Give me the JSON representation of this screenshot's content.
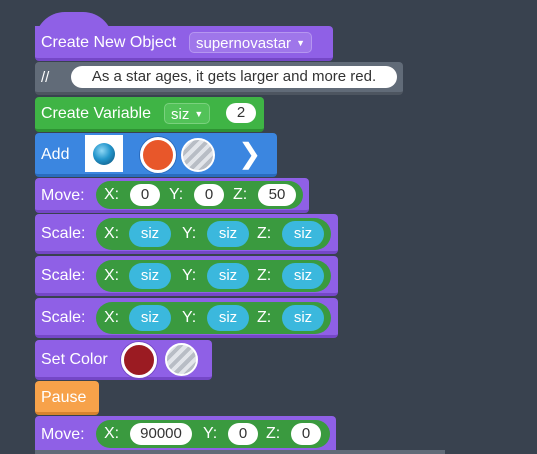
{
  "blocks": {
    "create_object": {
      "label": "Create New Object",
      "dropdown": "supernovastar"
    },
    "comment": {
      "marker": "//",
      "text": "As a star ages, it gets larger and more red."
    },
    "create_variable": {
      "label": "Create Variable",
      "dropdown": "siz",
      "value": "2"
    },
    "add": {
      "label": "Add",
      "arrow": "chevron-right-icon"
    },
    "move1": {
      "label": "Move:",
      "x_label": "X:",
      "x": "0",
      "y_label": "Y:",
      "y": "0",
      "z_label": "Z:",
      "z": "50"
    },
    "scales": [
      {
        "label": "Scale:",
        "x_label": "X:",
        "x": "siz",
        "y_label": "Y:",
        "y": "siz",
        "z_label": "Z:",
        "z": "siz"
      },
      {
        "label": "Scale:",
        "x_label": "X:",
        "x": "siz",
        "y_label": "Y:",
        "y": "siz",
        "z_label": "Z:",
        "z": "siz"
      },
      {
        "label": "Scale:",
        "x_label": "X:",
        "x": "siz",
        "y_label": "Y:",
        "y": "siz",
        "z_label": "Z:",
        "z": "siz"
      }
    ],
    "set_color": {
      "label": "Set Color"
    },
    "pause": {
      "label": "Pause"
    },
    "move2": {
      "label": "Move:",
      "x_label": "X:",
      "x": "90000",
      "y_label": "Y:",
      "y": "0",
      "z_label": "Z:",
      "z": "0"
    }
  },
  "colors": {
    "background": "#39424f",
    "purple": "#8f60e6",
    "green": "#3fb445",
    "blue": "#3b86e0",
    "orange": "#f7a24a",
    "cyan": "#3bb8dd",
    "selected_color_red": "#9b1b22",
    "selected_color_orange": "#e8572a"
  }
}
